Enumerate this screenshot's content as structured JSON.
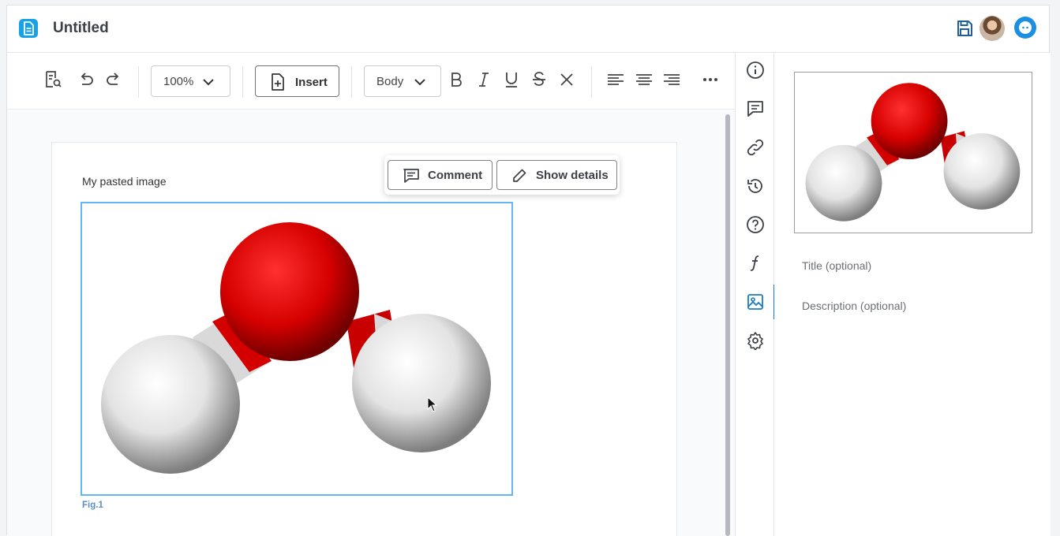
{
  "header": {
    "doc_title": "Untitled"
  },
  "toolbar": {
    "zoom_value": "100%",
    "insert_label": "Insert",
    "style_value": "Body"
  },
  "document": {
    "paragraph": "My pasted image",
    "caption": "Fig.1"
  },
  "popup": {
    "comment_label": "Comment",
    "show_details_label": "Show details"
  },
  "panel": {
    "title_placeholder": "Title (optional)",
    "description_placeholder": "Description (optional)"
  },
  "sidebar": {
    "items": [
      "info-icon",
      "comments-icon",
      "link-icon",
      "history-icon",
      "help-icon",
      "formula-icon",
      "image-icon",
      "settings-icon"
    ],
    "active": "image-icon"
  },
  "colors": {
    "accent": "#1a7bc7",
    "selection": "#64b5f6",
    "brand": "#1aa0e6"
  }
}
